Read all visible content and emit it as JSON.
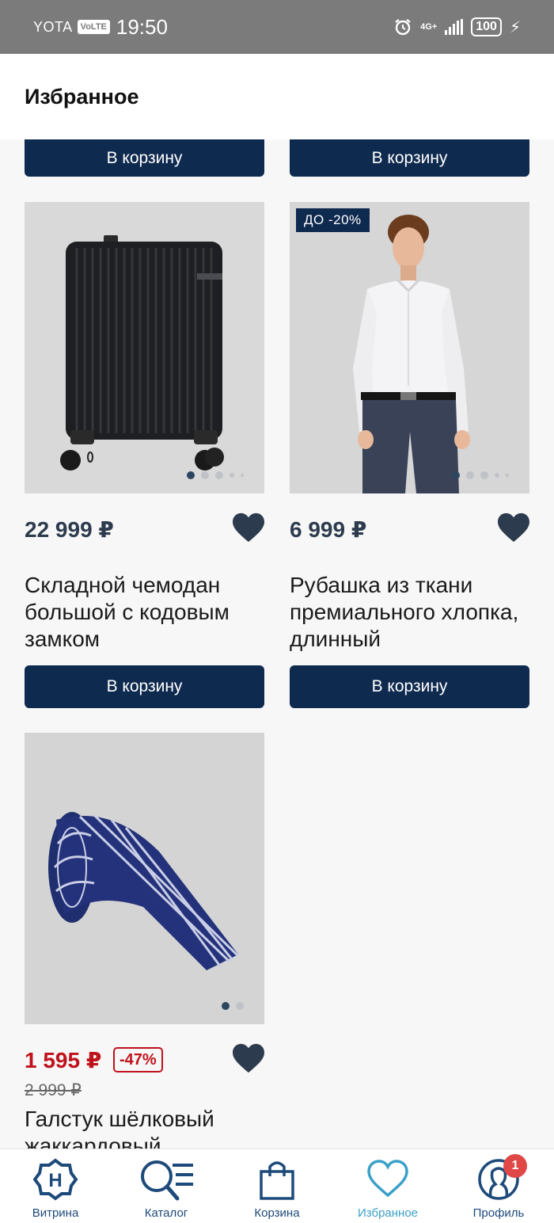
{
  "status_bar": {
    "carrier": "YOTA",
    "volte": "VoLTE",
    "time": "19:50",
    "network": "4G+",
    "battery": "100"
  },
  "header": {
    "title": "Избранное"
  },
  "top_buttons": {
    "left_label": "В корзину",
    "right_label": "В корзину"
  },
  "products": [
    {
      "price": "22 999 ₽",
      "title": "Складной чемодан большой с кодовым замком",
      "cart_label": "В корзину",
      "image_icon": "suitcase-image"
    },
    {
      "badge": "ДО -20%",
      "price": "6 999 ₽",
      "title": "Рубашка из ткани премиального хлопка, длинный",
      "cart_label": "В корзину",
      "image_icon": "shirt-image"
    },
    {
      "price": "1 595 ₽",
      "discount": "-47%",
      "old_price": "2 999 ₽",
      "title": "Галстук шёлковый жаккардовый",
      "image_icon": "tie-image"
    }
  ],
  "colors": {
    "primary": "#0f2a4f",
    "sale": "#c0121b",
    "nav_active": "#3aa0c8",
    "nav": "#1d4a7a"
  },
  "nav": {
    "items": [
      {
        "label": "Витрина",
        "icon": "home-logo-icon"
      },
      {
        "label": "Каталог",
        "icon": "catalog-search-icon"
      },
      {
        "label": "Корзина",
        "icon": "bag-icon"
      },
      {
        "label": "Избранное",
        "icon": "heart-icon",
        "active": true
      },
      {
        "label": "Профиль",
        "icon": "profile-icon",
        "badge": "1"
      }
    ]
  }
}
